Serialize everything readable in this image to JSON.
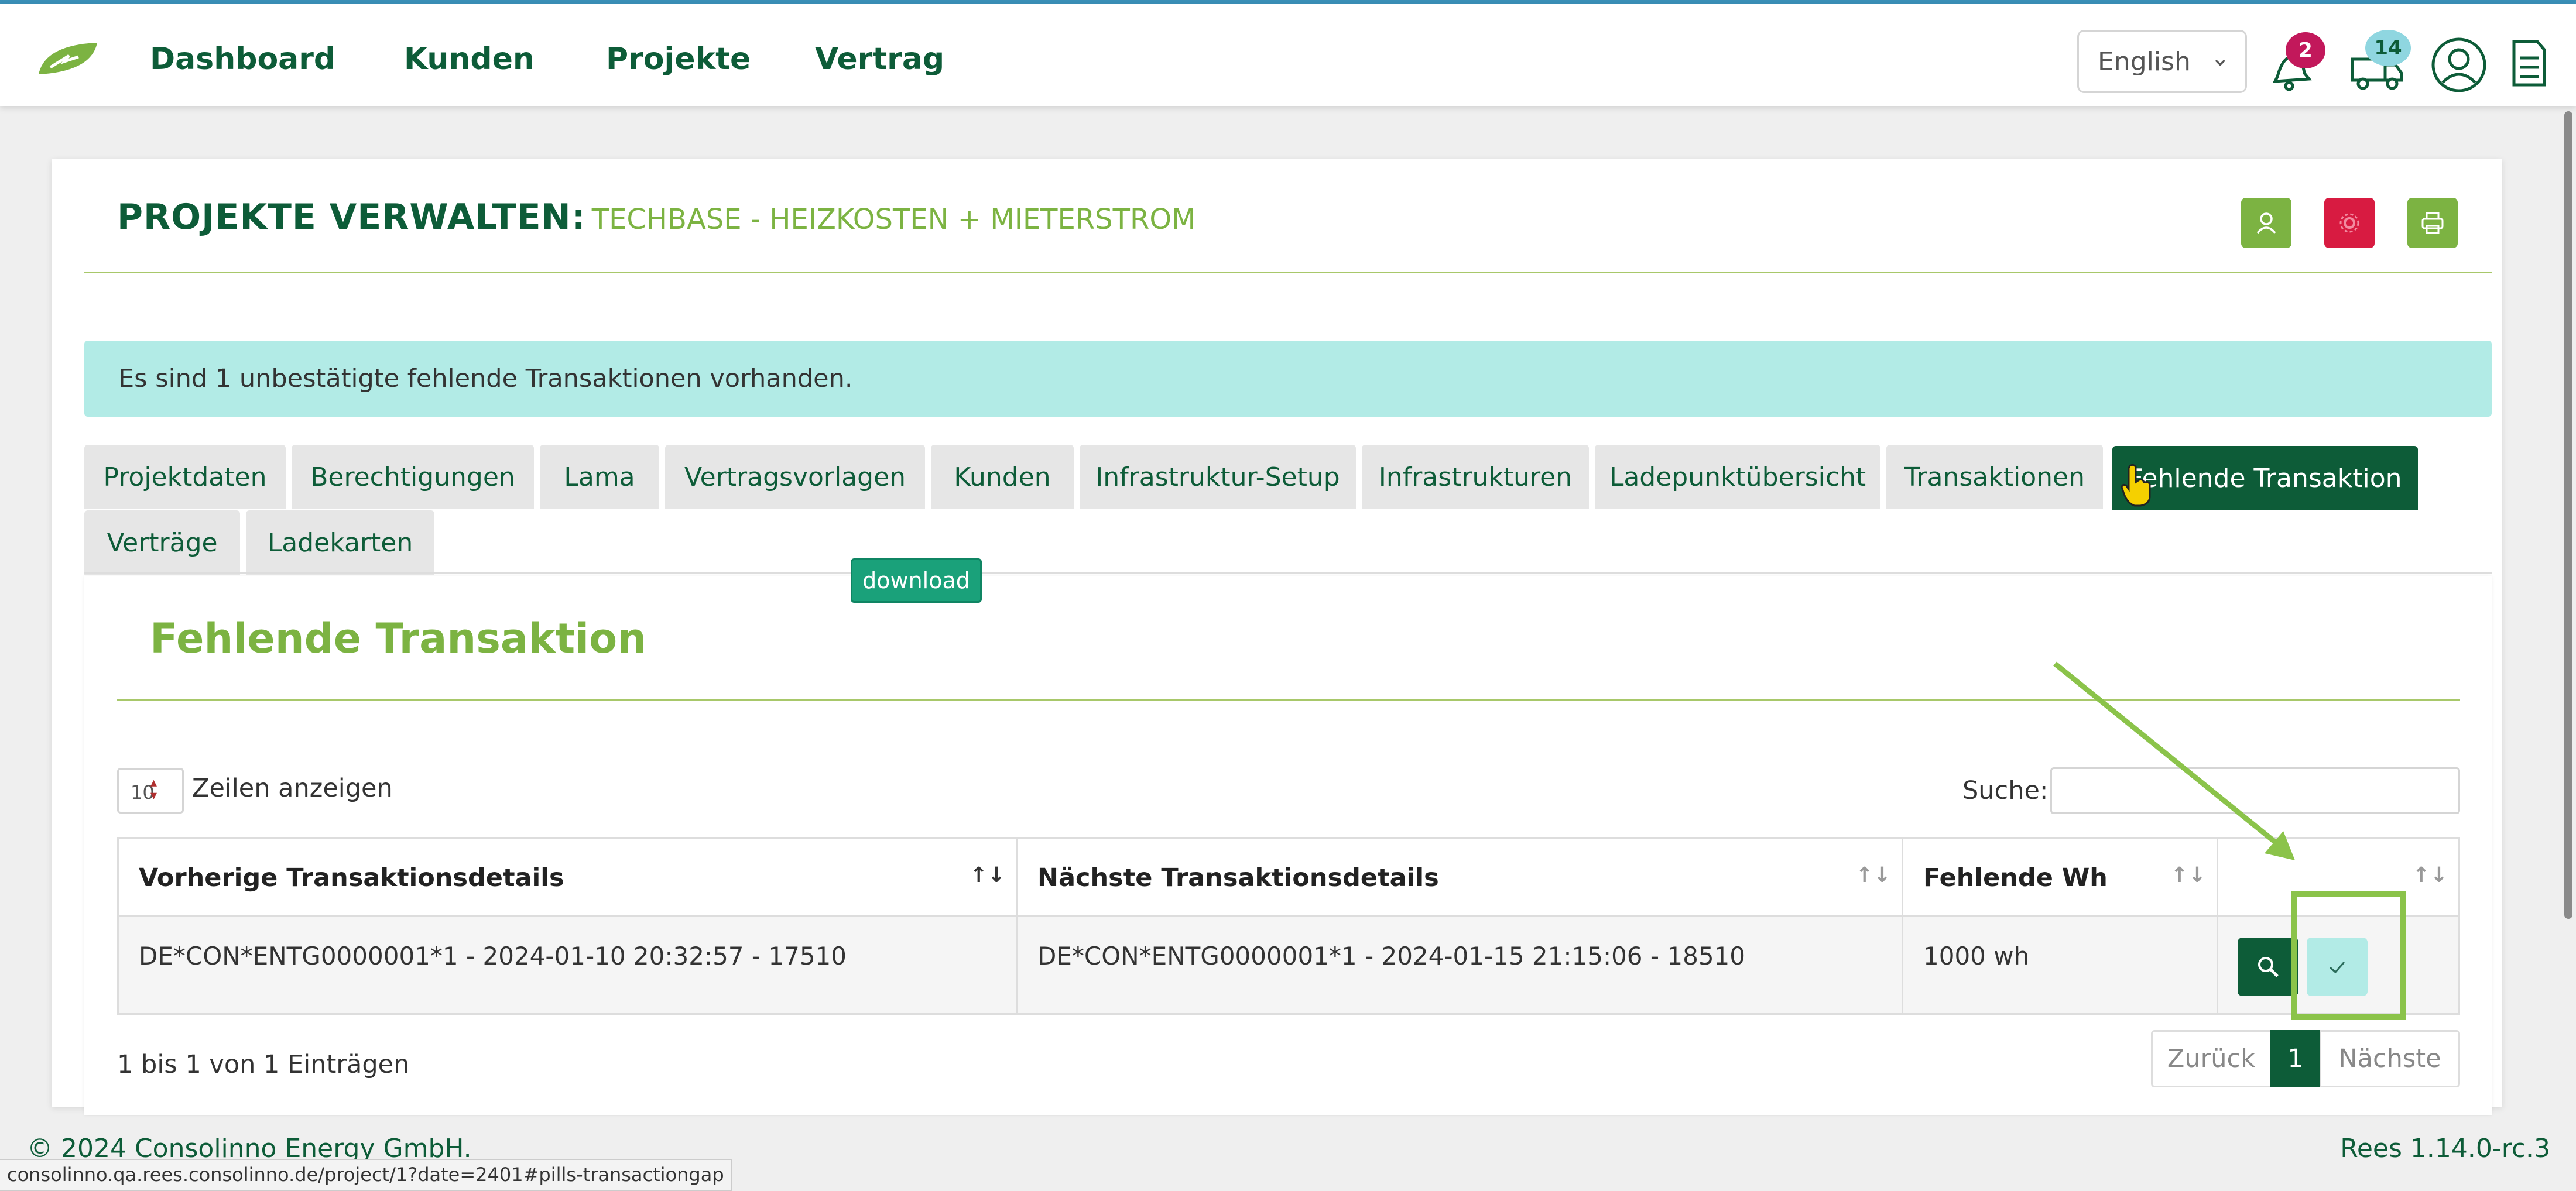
{
  "nav": {
    "items": [
      "Dashboard",
      "Kunden",
      "Projekte",
      "Vertrag"
    ],
    "language": "English",
    "notification_count": "2",
    "truck_count": "14"
  },
  "header": {
    "title_strong": "PROJEKTE VERWALTEN:",
    "title_sub": "TECHBASE - HEIZKOSTEN + MIETERSTROM"
  },
  "alert": {
    "text": "Es sind 1 unbestätigte fehlende Transaktionen vorhanden."
  },
  "tabs": [
    "Projektdaten",
    "Berechtigungen",
    "Lama",
    "Vertragsvorlagen",
    "Kunden",
    "Infrastruktur-Setup",
    "Infrastrukturen",
    "Ladepunktübersicht",
    "Transaktionen",
    "Fehlende Transaktion",
    "Verträge",
    "Ladekarten"
  ],
  "active_tab": "Fehlende Transaktion",
  "tooltip": "download",
  "section": {
    "title": "Fehlende Transaktion",
    "length_value": "10",
    "length_label": "Zeilen anzeigen",
    "search_label": "Suche:"
  },
  "table": {
    "headers": [
      "Vorherige Transaktionsdetails",
      "Nächste Transaktionsdetails",
      "Fehlende Wh",
      ""
    ],
    "rows": [
      {
        "prev": "DE*CON*ENTG0000001*1 - 2024-01-10 20:32:57 - 17510",
        "next": "DE*CON*ENTG0000001*1 - 2024-01-15 21:15:06 - 18510",
        "missing": "1000 wh"
      }
    ]
  },
  "info": "1 bis 1 von 1 Einträgen",
  "pagination": {
    "prev": "Zurück",
    "current": "1",
    "next": "Nächste"
  },
  "footer": {
    "copyright": "© 2024 Consolinno Energy GmbH.",
    "version": "Rees 1.14.0-rc.3"
  },
  "status_url": "consolinno.qa.rees.consolinno.de/project/1?date=2401#pills-transactiongap",
  "colors": {
    "primary": "#0d5c38",
    "accent": "#7cb342",
    "danger": "#d81b41",
    "alert_bg": "#b2ebe6"
  }
}
